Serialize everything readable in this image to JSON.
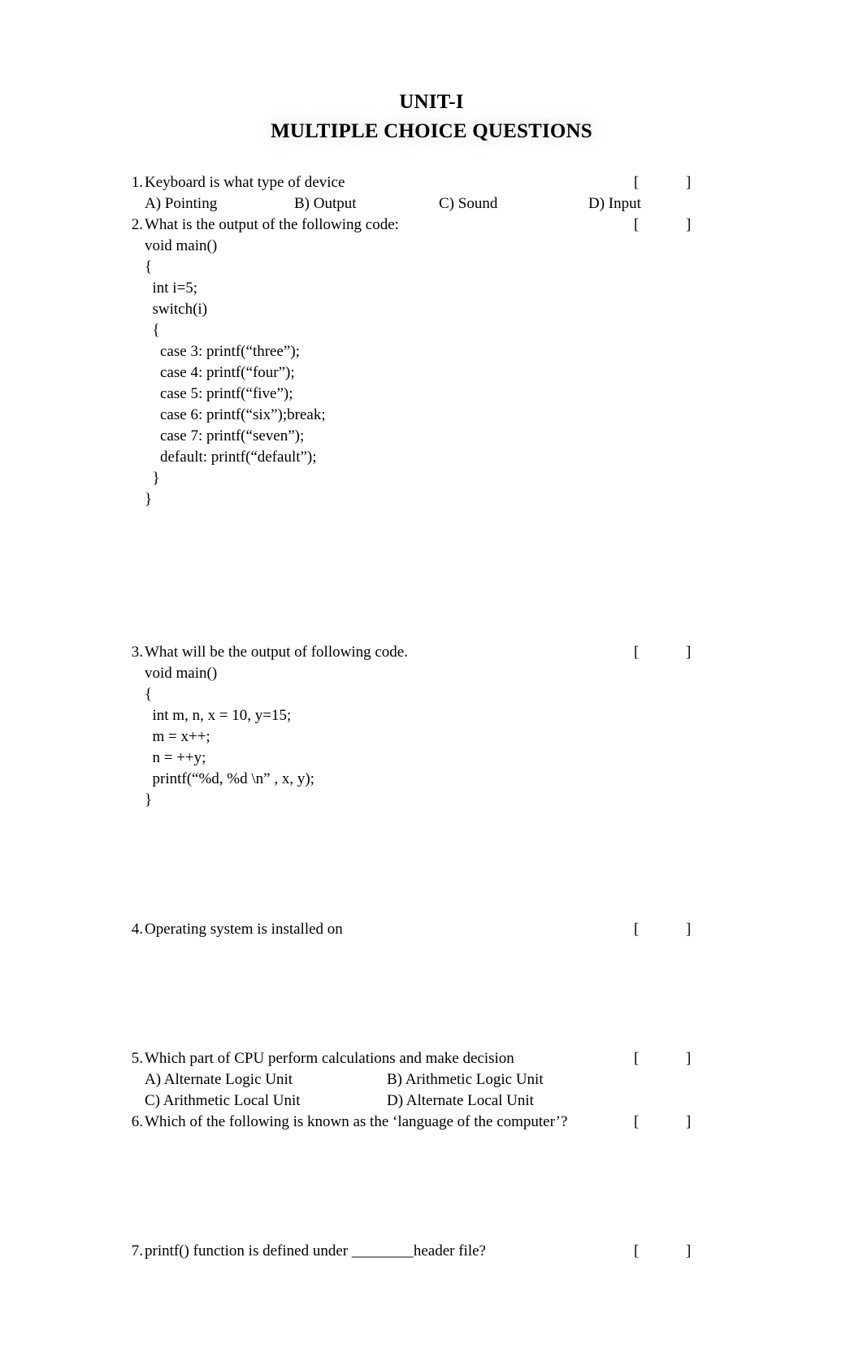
{
  "document": {
    "title": "UNIT-I",
    "subtitle": "MULTIPLE CHOICE QUESTIONS",
    "bracket_open": "[",
    "bracket_close": "]",
    "text_color": "#000000",
    "background_color": "#ffffff"
  },
  "questions": [
    {
      "number": "1.",
      "text": "Keyboard is what type of device",
      "options": [
        "A) Pointing",
        "B) Output",
        "C) Sound",
        "D) Input"
      ]
    },
    {
      "number": "2.",
      "text": "What is the output of the following code:",
      "code": [
        "void main()",
        "{",
        "  int i=5;",
        "  switch(i)",
        "  {",
        "    case 3: printf(“three”);",
        "    case 4: printf(“four”);",
        "    case 5: printf(“five”);",
        "    case 6: printf(“six”);break;",
        "    case 7: printf(“seven”);",
        "    default: printf(“default”);",
        "  }",
        "}"
      ]
    },
    {
      "number": "3.",
      "text": "What will be the output of following code.",
      "code": [
        "void main()",
        "{",
        "  int m, n, x = 10, y=15;",
        "  m = x++;",
        "  n = ++y;",
        "  printf(“%d, %d \\n” , x, y);",
        "}"
      ]
    },
    {
      "number": "4.",
      "text": "Operating system is installed on"
    },
    {
      "number": "5.",
      "text": "Which part of CPU perform calculations and make decision",
      "options": [
        "A) Alternate Logic Unit",
        "B) Arithmetic Logic Unit",
        "C) Arithmetic Local Unit",
        "D) Alternate Local Unit"
      ]
    },
    {
      "number": "6.",
      "text": "Which of the following is known as the ‘language of the computer’?"
    },
    {
      "number": "7.",
      "text": "printf() function is defined under ________header file?"
    }
  ]
}
